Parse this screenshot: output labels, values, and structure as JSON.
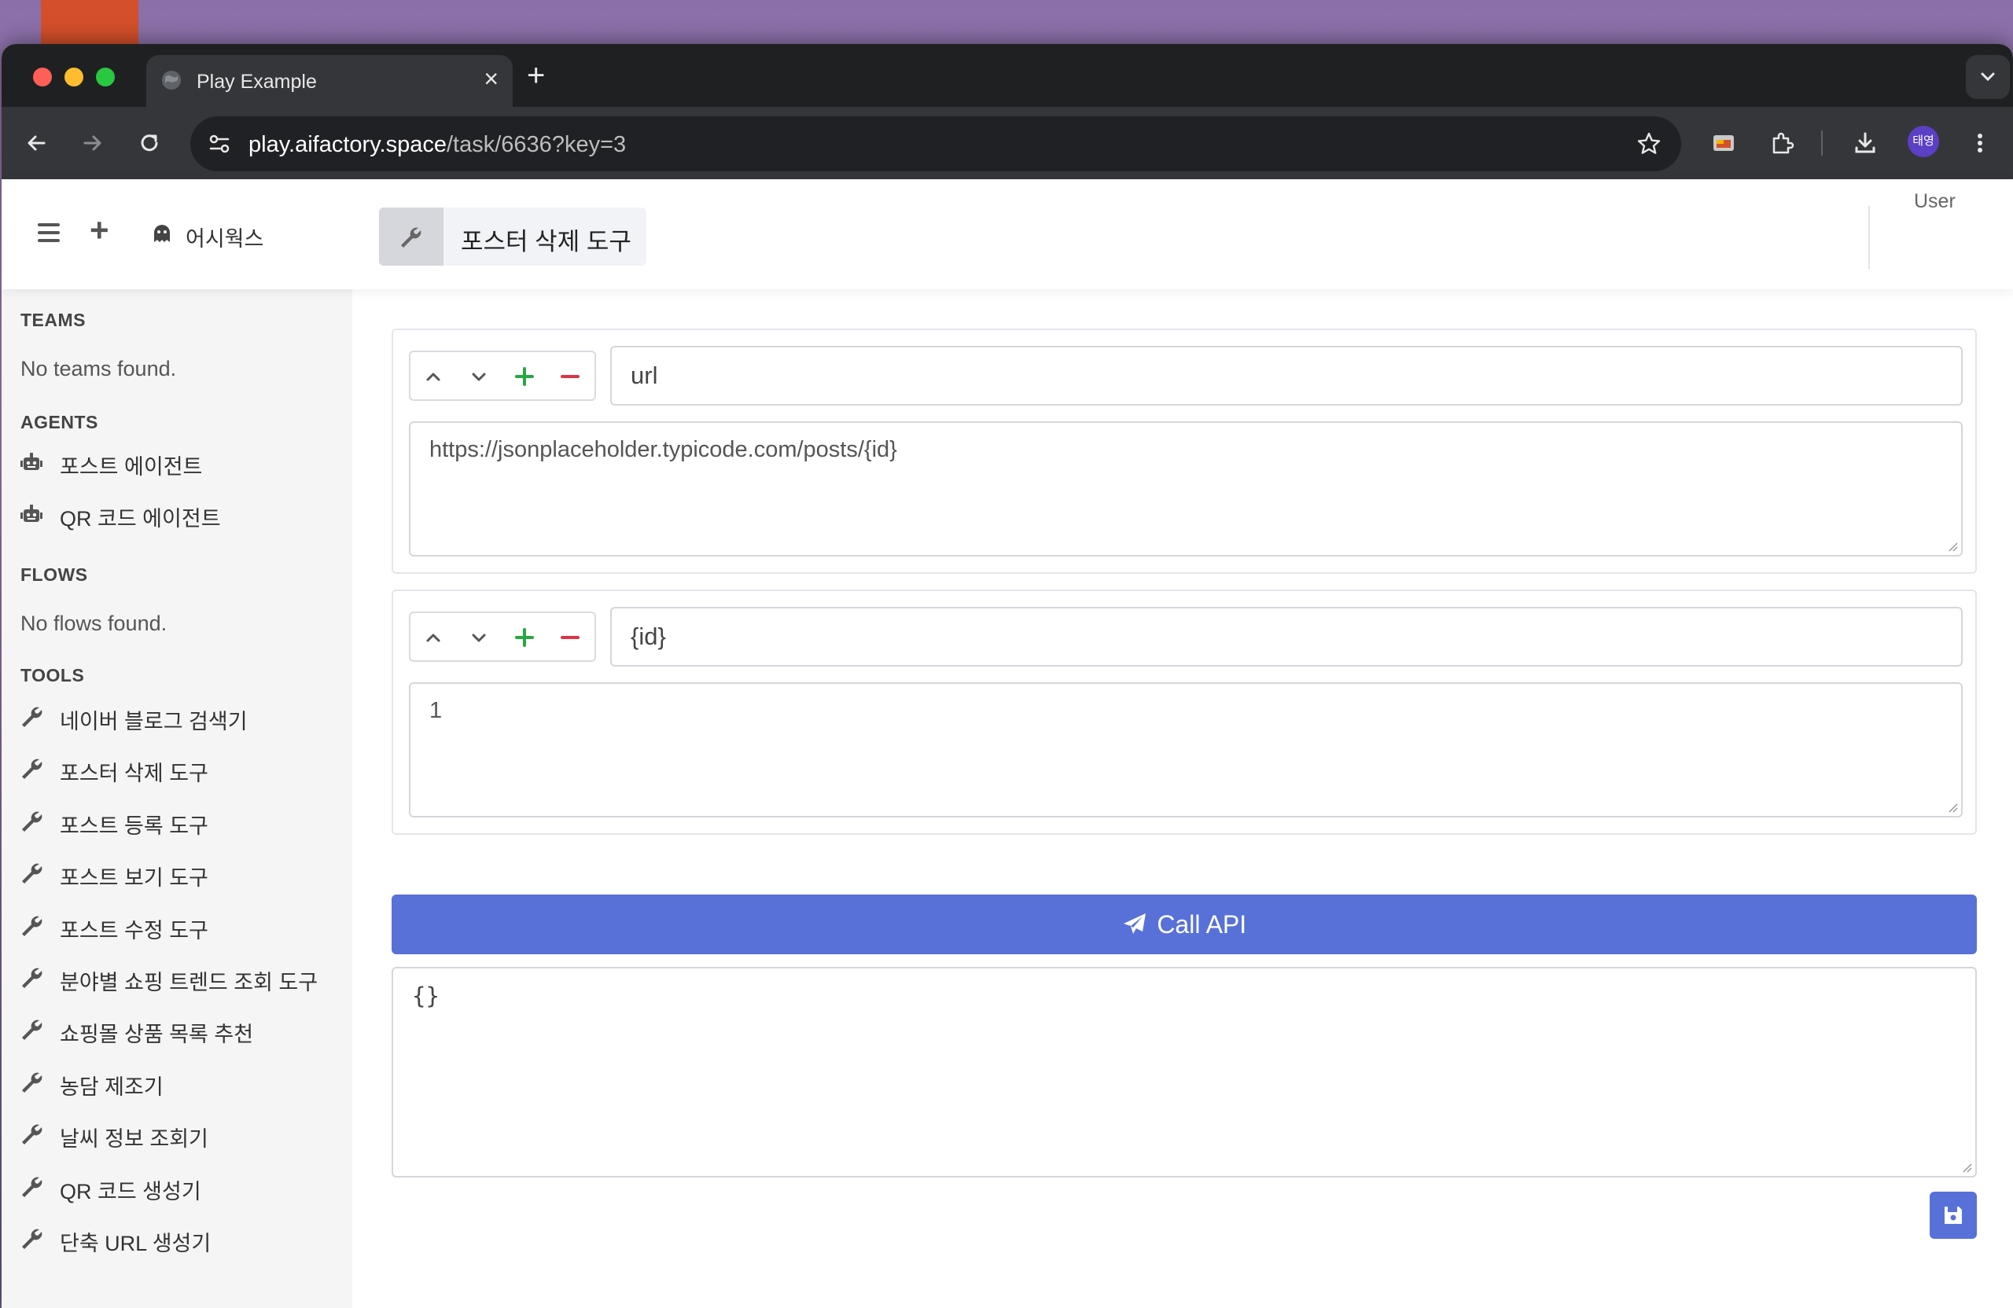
{
  "browser": {
    "tab_title": "Play Example",
    "url_host": "play.aifactory.space",
    "url_path": "/task/6636?key=3",
    "profile_initials": "태영"
  },
  "header": {
    "workspace_name": "어시웍스",
    "page_title": "포스터 삭제 도구",
    "user_label": "User"
  },
  "sidebar": {
    "teams_title": "TEAMS",
    "teams_empty": "No teams found.",
    "agents_title": "AGENTS",
    "agents": [
      {
        "label": "포스트 에이전트",
        "icon": "robot-icon"
      },
      {
        "label": "QR 코드 에이전트",
        "icon": "robot-icon"
      }
    ],
    "flows_title": "FLOWS",
    "flows_empty": "No flows found.",
    "tools_title": "TOOLS",
    "tools": [
      {
        "label": "네이버 블로그 검색기",
        "icon": "wrench-icon"
      },
      {
        "label": "포스터 삭제 도구",
        "icon": "wrench-icon"
      },
      {
        "label": "포스트 등록 도구",
        "icon": "wrench-icon"
      },
      {
        "label": "포스트 보기 도구",
        "icon": "wrench-icon"
      },
      {
        "label": "포스트 수정 도구",
        "icon": "wrench-icon"
      },
      {
        "label": "분야별 쇼핑 트렌드 조회 도구",
        "icon": "wrench-icon"
      },
      {
        "label": "쇼핑몰 상품 목록 추천",
        "icon": "wrench-icon"
      },
      {
        "label": "농담 제조기",
        "icon": "wrench-icon"
      },
      {
        "label": "날씨 정보 조회기",
        "icon": "wrench-icon"
      },
      {
        "label": "QR 코드 생성기",
        "icon": "wrench-icon"
      },
      {
        "label": "단축 URL 생성기",
        "icon": "wrench-icon"
      }
    ]
  },
  "params": [
    {
      "key": "url",
      "value": "https://jsonplaceholder.typicode.com/posts/{id}"
    },
    {
      "key": "{id}",
      "value": "1"
    }
  ],
  "actions": {
    "call_api_label": "Call API"
  },
  "output": {
    "value": "{}"
  },
  "colors": {
    "primary": "#5871d8",
    "add_green": "#28a745",
    "remove_red": "#dc3545"
  }
}
